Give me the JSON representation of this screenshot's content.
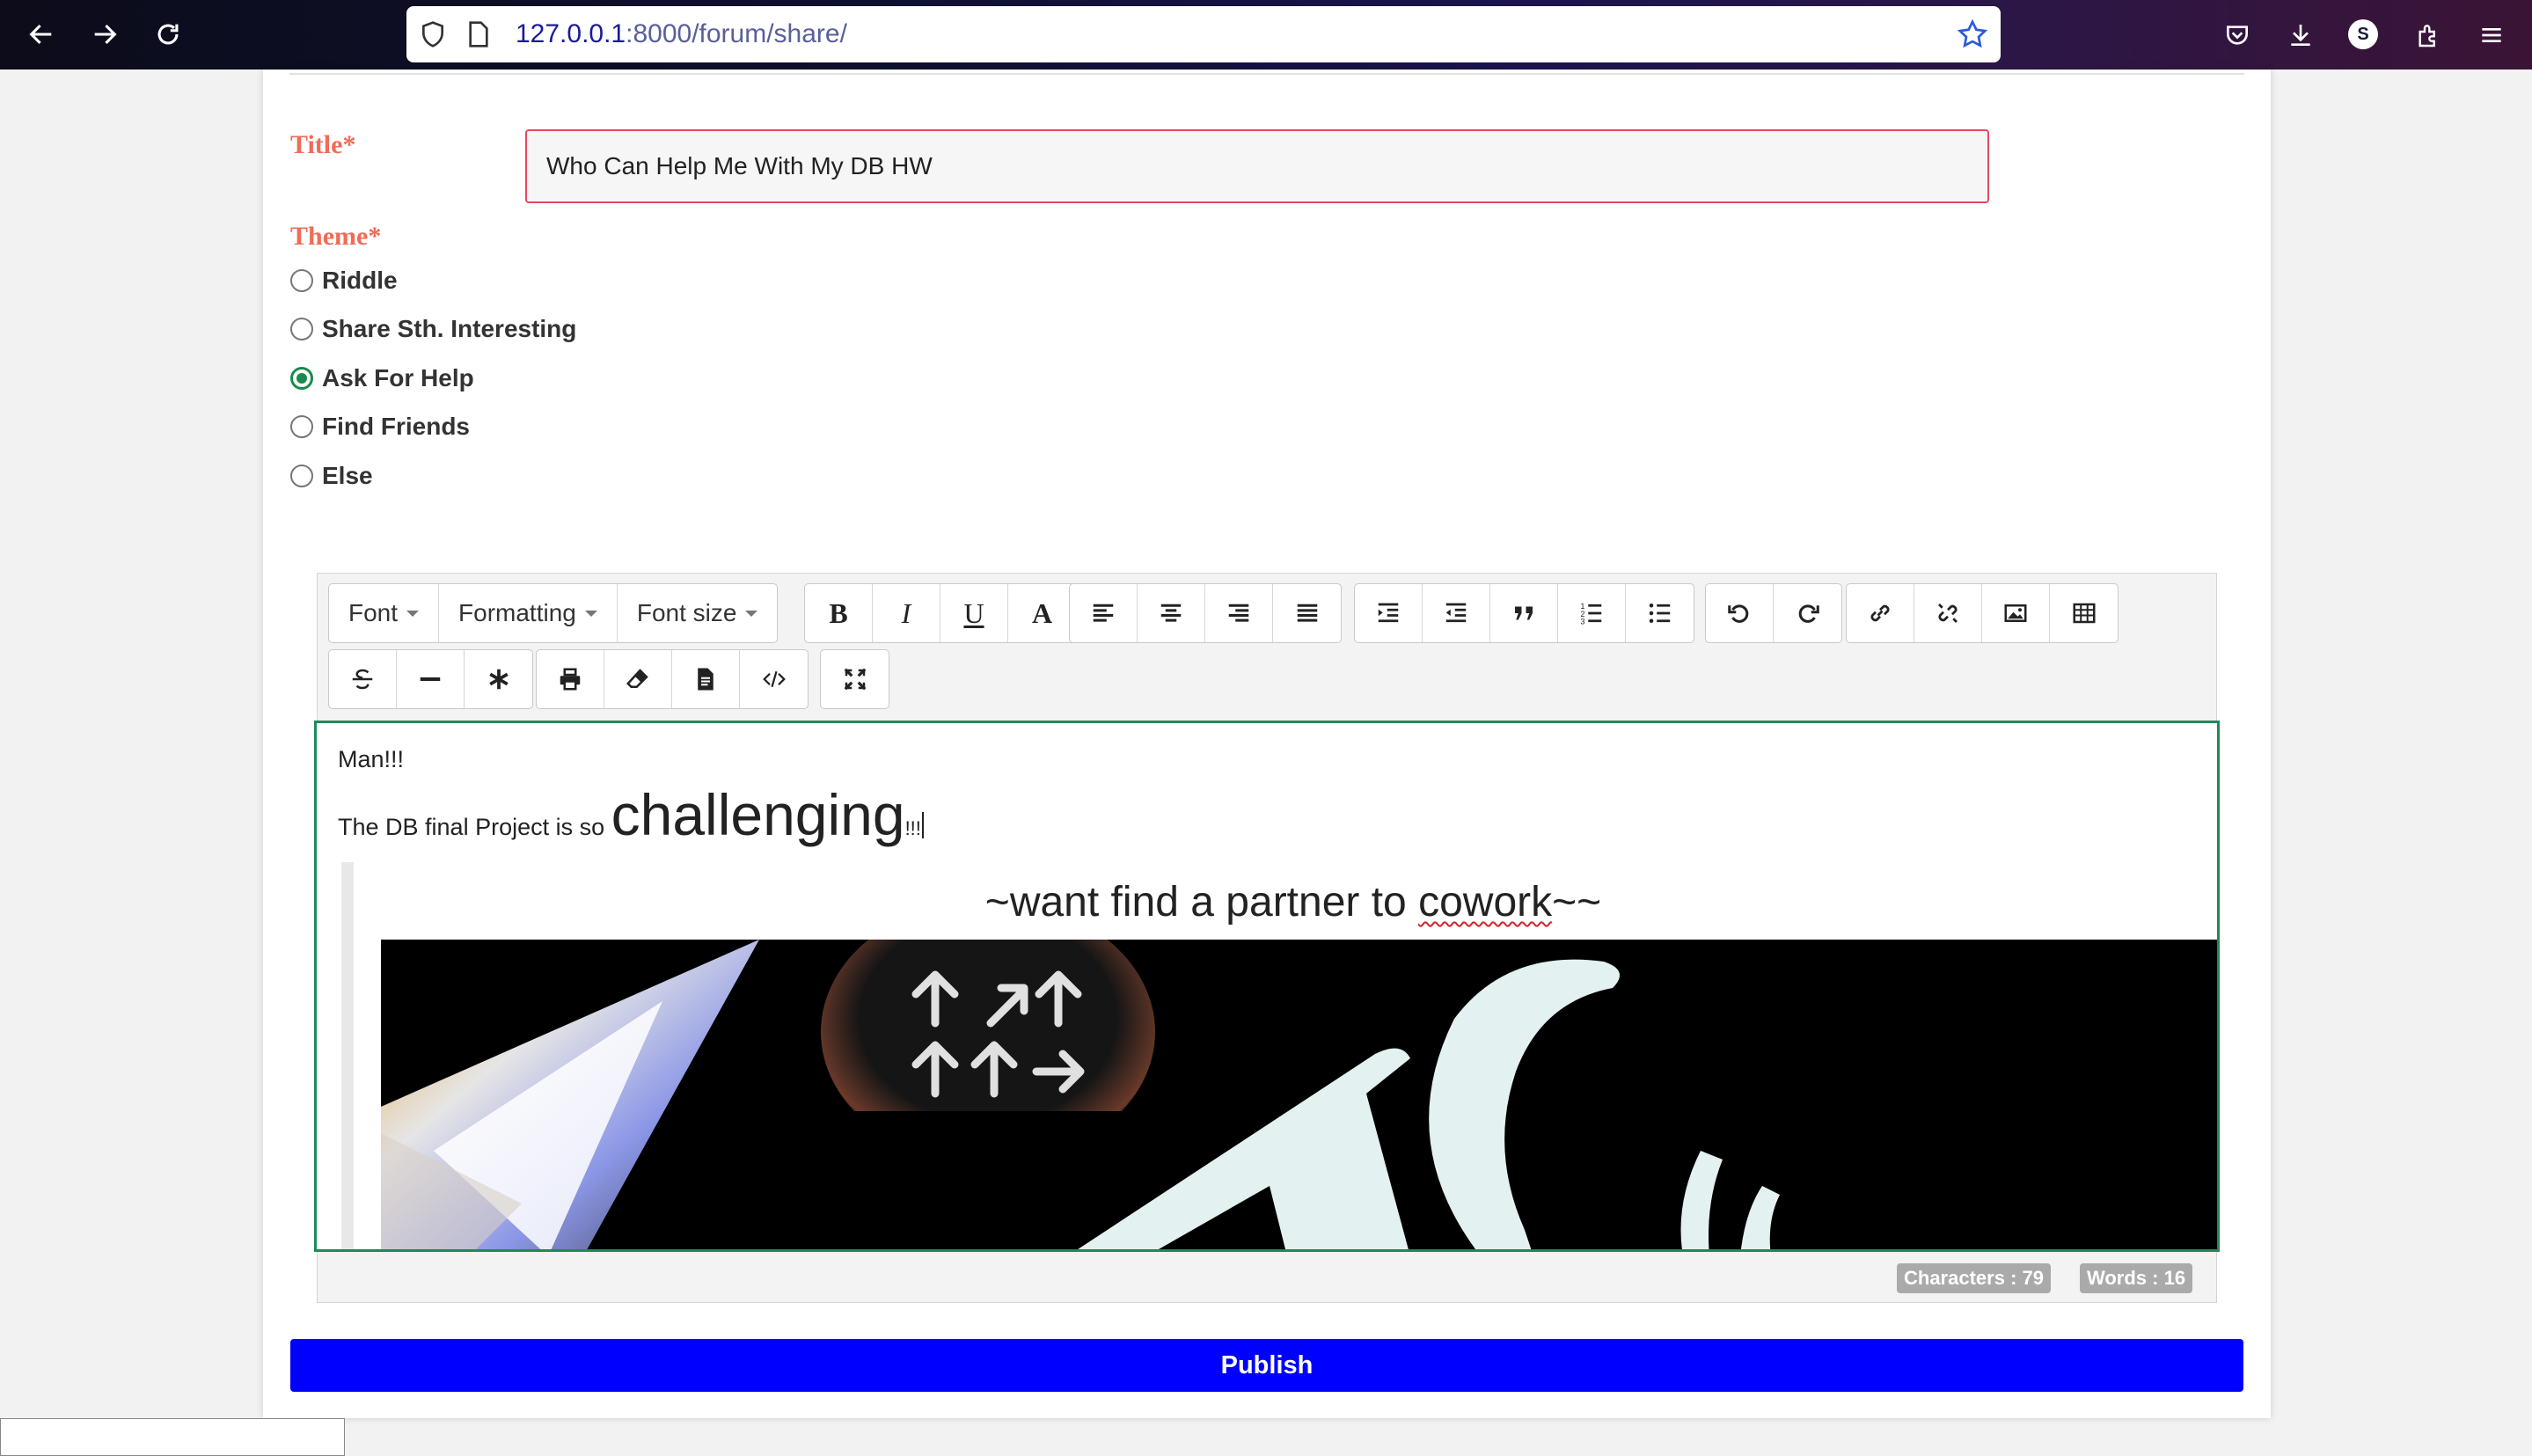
{
  "browser": {
    "url_host": "127.0.0.1",
    "url_path": ":8000/forum/share/",
    "profile_initial": "S"
  },
  "form": {
    "title_label": "Title*",
    "title_value": "Who Can Help Me With My DB HW",
    "theme_label": "Theme*",
    "themes": [
      {
        "label": "Riddle",
        "checked": false
      },
      {
        "label": "Share Sth. Interesting",
        "checked": false
      },
      {
        "label": "Ask For Help",
        "checked": true
      },
      {
        "label": "Find Friends",
        "checked": false
      },
      {
        "label": "Else",
        "checked": false
      }
    ]
  },
  "toolbar": {
    "font_label": "Font",
    "formatting_label": "Formatting",
    "font_size_label": "Font size",
    "bold_glyph": "B",
    "italic_glyph": "I",
    "underline_glyph": "U",
    "color_glyph": "A"
  },
  "editor": {
    "line1": "Man!!!",
    "line2_prefix": "The DB final Project is so ",
    "line2_big": "challenging",
    "line2_suffix": "!!!",
    "center_before": "~want find a partner to ",
    "center_misspelled": "cowork",
    "center_after": "~~"
  },
  "status": {
    "characters": "Characters : 79",
    "words": "Words : 16"
  },
  "publish_label": "Publish"
}
